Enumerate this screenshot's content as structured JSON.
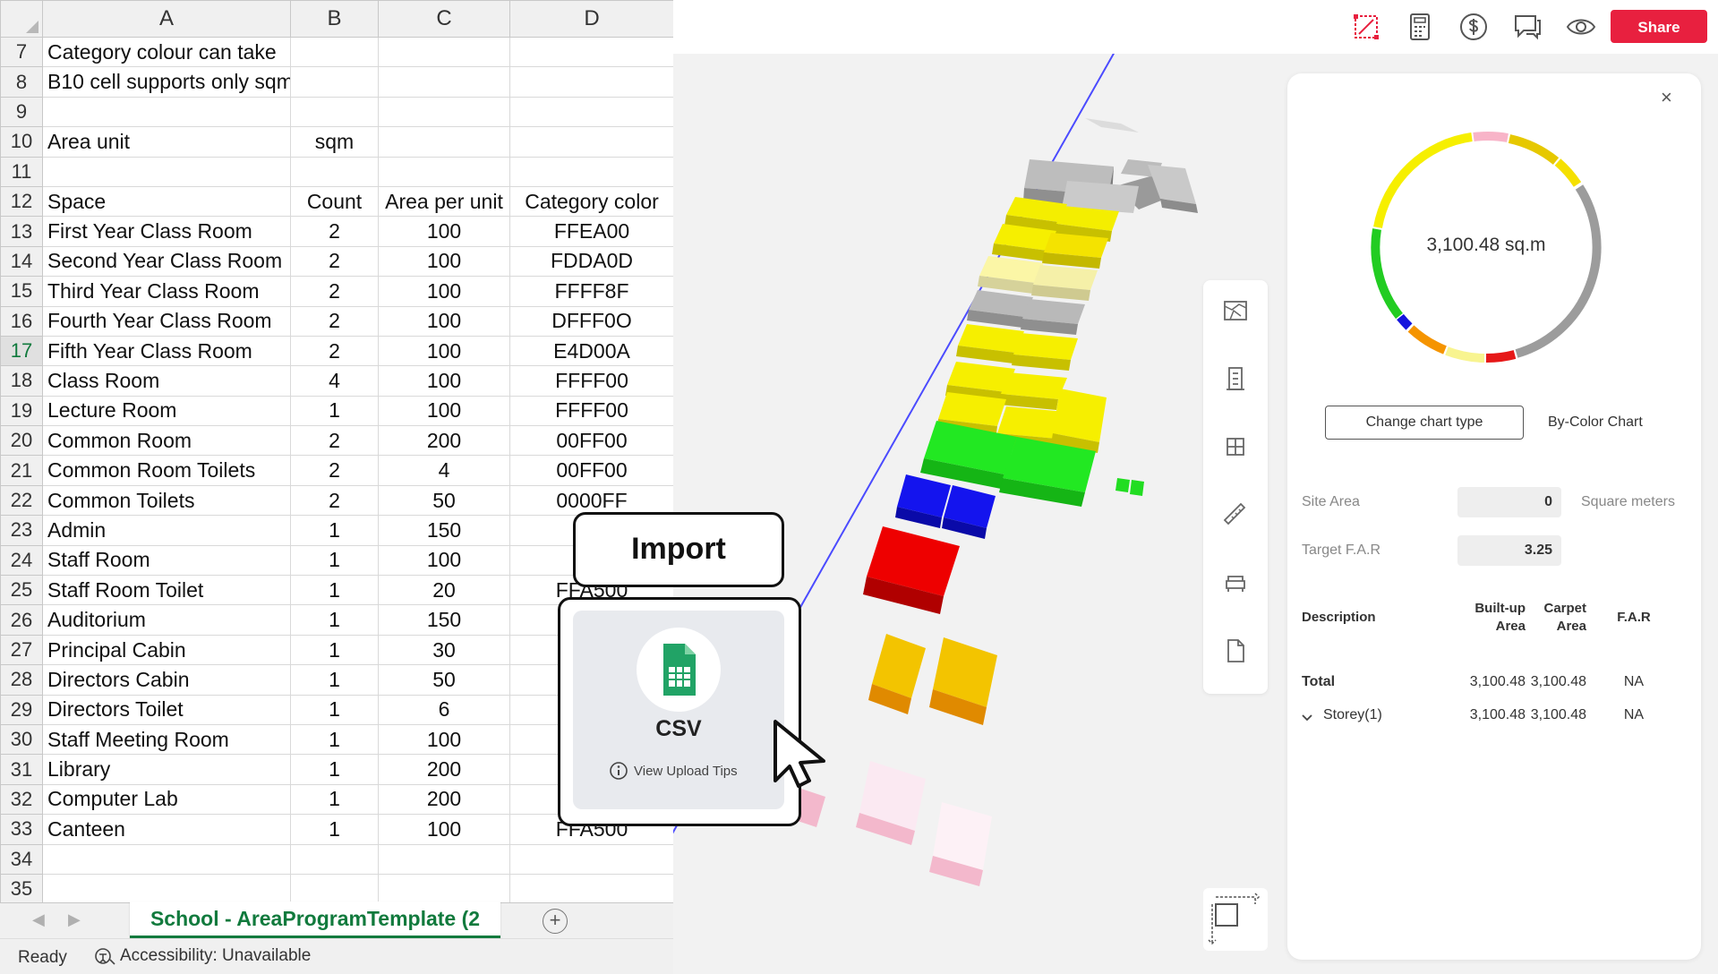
{
  "spreadsheet": {
    "columns": [
      "A",
      "B",
      "C",
      "D"
    ],
    "rows": [
      {
        "num": "7",
        "cells": [
          "Category colour can take",
          "",
          "",
          ""
        ]
      },
      {
        "num": "8",
        "cells": [
          "B10 cell supports only sqm/ sqft",
          "",
          "",
          ""
        ]
      },
      {
        "num": "9",
        "cells": [
          "",
          "",
          "",
          ""
        ]
      },
      {
        "num": "10",
        "cells": [
          "Area unit",
          "sqm",
          "",
          ""
        ]
      },
      {
        "num": "11",
        "cells": [
          "",
          "",
          "",
          ""
        ]
      },
      {
        "num": "12",
        "cells": [
          "Space",
          "Count",
          "Area per unit",
          "Category color"
        ]
      },
      {
        "num": "13",
        "cells": [
          "First Year Class Room",
          "2",
          "100",
          "FFEA00"
        ]
      },
      {
        "num": "14",
        "cells": [
          "Second Year Class Room",
          "2",
          "100",
          "FDDA0D"
        ]
      },
      {
        "num": "15",
        "cells": [
          "Third Year Class Room",
          "2",
          "100",
          "FFFF8F"
        ]
      },
      {
        "num": "16",
        "cells": [
          "Fourth Year Class Room",
          "2",
          "100",
          "DFFF0O"
        ]
      },
      {
        "num": "17",
        "cells": [
          "Fifth Year Class Room",
          "2",
          "100",
          "E4D00A"
        ]
      },
      {
        "num": "18",
        "cells": [
          "Class Room",
          "4",
          "100",
          "FFFF00"
        ]
      },
      {
        "num": "19",
        "cells": [
          "Lecture Room",
          "1",
          "100",
          "FFFF00"
        ]
      },
      {
        "num": "20",
        "cells": [
          "Common Room",
          "2",
          "200",
          "00FF00"
        ]
      },
      {
        "num": "21",
        "cells": [
          "Common Room Toilets",
          "2",
          "4",
          "00FF00"
        ]
      },
      {
        "num": "22",
        "cells": [
          "Common Toilets",
          "2",
          "50",
          "0000FF"
        ]
      },
      {
        "num": "23",
        "cells": [
          "Admin",
          "1",
          "150",
          "F"
        ]
      },
      {
        "num": "24",
        "cells": [
          "Staff Room",
          "1",
          "100",
          "F"
        ]
      },
      {
        "num": "25",
        "cells": [
          "Staff Room Toilet",
          "1",
          "20",
          "FFA500"
        ]
      },
      {
        "num": "26",
        "cells": [
          "Auditorium",
          "1",
          "150",
          ""
        ]
      },
      {
        "num": "27",
        "cells": [
          "Principal Cabin",
          "1",
          "30",
          ""
        ]
      },
      {
        "num": "28",
        "cells": [
          "Directors Cabin",
          "1",
          "50",
          ""
        ]
      },
      {
        "num": "29",
        "cells": [
          "Directors Toilet",
          "1",
          "6",
          ""
        ]
      },
      {
        "num": "30",
        "cells": [
          "Staff Meeting Room",
          "1",
          "100",
          ""
        ]
      },
      {
        "num": "31",
        "cells": [
          "Library",
          "1",
          "200",
          ""
        ]
      },
      {
        "num": "32",
        "cells": [
          "Computer Lab",
          "1",
          "200",
          ""
        ]
      },
      {
        "num": "33",
        "cells": [
          "Canteen",
          "1",
          "100",
          "FFA500"
        ]
      },
      {
        "num": "34",
        "cells": [
          "",
          "",
          "",
          ""
        ]
      },
      {
        "num": "35",
        "cells": [
          "",
          "",
          "",
          ""
        ]
      }
    ],
    "selected_row": "17",
    "sheet_tab": "School - AreaProgramTemplate (2",
    "nav_prev": "◀",
    "nav_next": "▶",
    "add_sheet": "+",
    "status": "Ready",
    "accessibility": "Accessibility: Unavailable"
  },
  "topbar": {
    "icons": [
      "site-plan-icon",
      "calculator-icon",
      "dollar-icon",
      "comment-icon",
      "eye-icon"
    ],
    "share_label": "Share",
    "accent": "#e8203f"
  },
  "toolbar": {
    "icons": [
      "map-icon",
      "building-icon",
      "grid-icon",
      "ruler-icon",
      "furniture-icon",
      "document-icon"
    ]
  },
  "panel": {
    "close": "×",
    "total_area": "3,100.48 sq.m",
    "change_chart_label": "Change chart type",
    "chart_type": "By-Color Chart",
    "site_area_label": "Site Area",
    "site_area_value": "0",
    "site_area_unit": "Square meters",
    "far_label": "Target F.A.R",
    "far_value": "3.25",
    "table": {
      "headers": [
        "Description",
        "Built-up Area",
        "Carpet Area",
        "F.A.R"
      ],
      "rows": [
        {
          "desc": "Total",
          "built": "3,100.48",
          "carpet": "3,100.48",
          "far": "NA"
        },
        {
          "desc": "Storey(1)",
          "built": "3,100.48",
          "carpet": "3,100.48",
          "far": "NA"
        }
      ]
    }
  },
  "import_overlay": {
    "title": "Import",
    "format": "CSV",
    "tips": "View Upload Tips"
  }
}
